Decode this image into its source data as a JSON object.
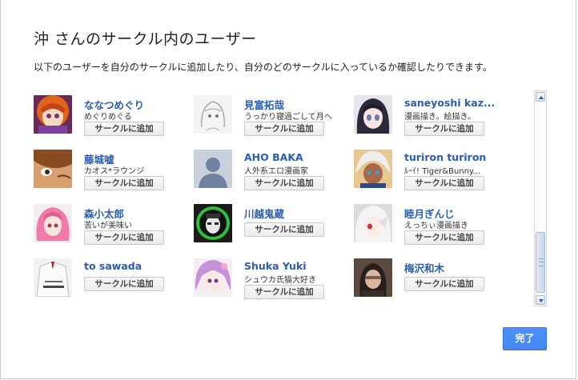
{
  "dialog": {
    "title": "沖 さんのサークル内のユーザー",
    "subtitle": "以下のユーザーを自分のサークルに追加したり、自分のどのサークルに入っているか確認したりできます。",
    "done_label": "完了"
  },
  "users": [
    {
      "name": "ななつめぐり",
      "desc": "めぐりめぐる",
      "button": "サークルに追加",
      "avatar": "anime-red-hair"
    },
    {
      "name": "見富拓哉",
      "desc": "うっかり寝過ごして月へ",
      "button": "サークルに追加",
      "avatar": "sketch-girl"
    },
    {
      "name": "saneyoshi kaz...",
      "desc": "漫画描き。絵描き。",
      "button": "サークルに追加",
      "avatar": "anime-dark-hair"
    },
    {
      "name": "藤城嘘",
      "desc": "カオス*ラウンジ",
      "button": "サークルに追加",
      "avatar": "anime-closeup"
    },
    {
      "name": "AHO BAKA",
      "desc": "人外系エロ漫画家",
      "button": "サークルに追加",
      "avatar": "default-silhouette"
    },
    {
      "name": "turiron turiron",
      "desc": "ﾙｰｲ! Tiger&Bunny...",
      "button": "サークルに追加",
      "avatar": "anime-white-hair"
    },
    {
      "name": "森小太郎",
      "desc": "苦いが美味い",
      "button": "サークルに追加",
      "avatar": "anime-pink-hair"
    },
    {
      "name": "川越鬼蔵",
      "desc": "",
      "button": "サークルに追加",
      "avatar": "green-circle-face"
    },
    {
      "name": "睦月ぎんじ",
      "desc": "えっちぃ漫画描き",
      "button": "サークルに追加",
      "avatar": "anime-silver-hair"
    },
    {
      "name": "to sawada",
      "desc": "",
      "button": "サークルに追加",
      "avatar": "emirates-shirt"
    },
    {
      "name": "Shuka Yuki",
      "desc": "シュウカ氏猫大好き",
      "button": "サークルに追加",
      "avatar": "anime-purple-hair"
    },
    {
      "name": "梅沢和木",
      "desc": "",
      "button": "サークルに追加",
      "avatar": "photo-person"
    }
  ]
}
